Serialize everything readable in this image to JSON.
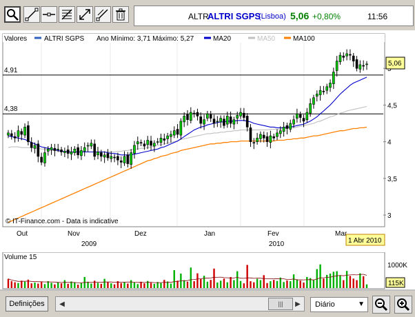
{
  "toolbar": {
    "icons": [
      "zoom-select-icon",
      "trend-line-icon",
      "horizontal-line-icon",
      "fibonacci-icon",
      "expand-arrows-icon",
      "diagonal-line-icon",
      "trash-icon"
    ]
  },
  "quote": {
    "ticker": "ALTR",
    "name": "ALTRI SGPS",
    "exchange": "(Lisboa)",
    "price": "5,06",
    "change": "+0,80%",
    "time": "11:56",
    "change_color": "#008000"
  },
  "legend": {
    "valores": "Valores",
    "series_name": "ALTRI SGPS",
    "range_text": "Ano Mínimo: 3,71 Máximo: 5,27",
    "ma20": "MA20",
    "ma50": "MA50",
    "ma100": "MA100",
    "colors": {
      "series": "#3060c0",
      "ma20": "#0000cc",
      "ma50": "#c0c0c0",
      "ma100": "#ff8000"
    }
  },
  "horizontal_lines": [
    {
      "label": "4,91",
      "value": 4.91
    },
    {
      "label": "4,38",
      "value": 4.38
    }
  ],
  "price_tag": "5,06",
  "watermark": "© IT-Finance.com - Data is indicative",
  "date_tag": "1 Abr 2010",
  "x_labels": {
    "months": [
      "Out",
      "Nov",
      "Dez",
      "Jan",
      "Fev",
      "Mar"
    ],
    "years": [
      "2009",
      "2010"
    ]
  },
  "volume": {
    "label": "Volume 15",
    "axis_top": "1000K",
    "current": "115K"
  },
  "chart_data": {
    "type": "candlestick",
    "y_axis_labels": [
      "5",
      "4,5",
      "4",
      "3,5",
      "3"
    ],
    "ylim": [
      2.85,
      5.35
    ],
    "grid": false,
    "closes": [
      4.12,
      4.08,
      4.05,
      4.15,
      4.1,
      4.2,
      4.0,
      3.92,
      3.95,
      3.8,
      3.72,
      3.85,
      3.9,
      3.92,
      3.88,
      3.9,
      3.86,
      3.87,
      3.84,
      3.86,
      3.9,
      3.82,
      3.88,
      3.92,
      3.95,
      3.98,
      3.8,
      3.86,
      3.8,
      3.82,
      3.78,
      3.8,
      3.78,
      3.75,
      3.72,
      3.8,
      3.7,
      3.85,
      3.95,
      4.0,
      3.98,
      3.94,
      4.02,
      3.95,
      3.98,
      4.0,
      4.05,
      4.02,
      4.08,
      4.1,
      4.15,
      4.1,
      4.28,
      4.35,
      4.3,
      4.4,
      4.38,
      4.35,
      4.25,
      4.3,
      4.38,
      4.32,
      4.25,
      4.28,
      4.32,
      4.22,
      4.35,
      4.25,
      4.3,
      4.36,
      4.4,
      4.33,
      4.2,
      4.0,
      3.98,
      4.05,
      4.1,
      4.05,
      4.0,
      4.08,
      4.05,
      4.12,
      4.15,
      4.2,
      4.18,
      4.25,
      4.3,
      4.38,
      4.33,
      4.28,
      4.4,
      4.52,
      4.6,
      4.65,
      4.7,
      4.68,
      4.75,
      4.8,
      4.95,
      5.1,
      5.18,
      5.15,
      5.2,
      5.18,
      5.1,
      5.0,
      5.05,
      5.03,
      5.06
    ],
    "ma20": [
      4.08,
      4.07,
      4.06,
      4.05,
      4.04,
      4.03,
      4.01,
      3.99,
      3.97,
      3.95,
      3.93,
      3.92,
      3.91,
      3.9,
      3.89,
      3.88,
      3.87,
      3.87,
      3.86,
      3.86,
      3.86,
      3.86,
      3.86,
      3.86,
      3.86,
      3.86,
      3.86,
      3.86,
      3.86,
      3.86,
      3.85,
      3.84,
      3.84,
      3.83,
      3.82,
      3.82,
      3.82,
      3.82,
      3.83,
      3.84,
      3.85,
      3.86,
      3.87,
      3.88,
      3.89,
      3.9,
      3.92,
      3.93,
      3.95,
      3.97,
      3.99,
      4.01,
      4.04,
      4.07,
      4.1,
      4.13,
      4.16,
      4.18,
      4.2,
      4.21,
      4.23,
      4.24,
      4.25,
      4.26,
      4.27,
      4.27,
      4.28,
      4.28,
      4.28,
      4.29,
      4.29,
      4.29,
      4.28,
      4.27,
      4.25,
      4.24,
      4.23,
      4.22,
      4.21,
      4.2,
      4.2,
      4.19,
      4.19,
      4.19,
      4.2,
      4.2,
      4.21,
      4.22,
      4.23,
      4.24,
      4.26,
      4.28,
      4.31,
      4.34,
      4.38,
      4.42,
      4.46,
      4.5,
      4.55,
      4.6,
      4.65,
      4.69,
      4.73,
      4.77,
      4.8,
      4.82,
      4.84,
      4.86,
      4.88
    ],
    "ma50": [
      3.92,
      3.93,
      3.93,
      3.93,
      3.92,
      3.92,
      3.92,
      3.92,
      3.91,
      3.91,
      3.9,
      3.9,
      3.89,
      3.88,
      3.88,
      3.87,
      3.87,
      3.87,
      3.87,
      3.86,
      3.86,
      3.86,
      3.86,
      3.86,
      3.86,
      3.86,
      3.86,
      3.86,
      3.86,
      3.86,
      3.86,
      3.86,
      3.86,
      3.87,
      3.87,
      3.88,
      3.88,
      3.89,
      3.9,
      3.9,
      3.91,
      3.91,
      3.92,
      3.93,
      3.94,
      3.95,
      3.96,
      3.97,
      3.98,
      3.99,
      4.0,
      4.01,
      4.03,
      4.04,
      4.05,
      4.06,
      4.07,
      4.08,
      4.09,
      4.1,
      4.11,
      4.11,
      4.12,
      4.12,
      4.13,
      4.13,
      4.14,
      4.14,
      4.15,
      4.15,
      4.16,
      4.16,
      4.16,
      4.16,
      4.16,
      4.16,
      4.16,
      4.16,
      4.16,
      4.17,
      4.17,
      4.17,
      4.17,
      4.18,
      4.18,
      4.19,
      4.19,
      4.2,
      4.21,
      4.22,
      4.23,
      4.24,
      4.25,
      4.27,
      4.28,
      4.3,
      4.32,
      4.34,
      4.35,
      4.37,
      4.39,
      4.4,
      4.42,
      4.43,
      4.44,
      4.45,
      4.46,
      4.47,
      4.48
    ],
    "ma100": [
      2.9,
      2.92,
      2.94,
      2.96,
      2.98,
      3.0,
      3.02,
      3.04,
      3.06,
      3.08,
      3.1,
      3.12,
      3.14,
      3.16,
      3.18,
      3.2,
      3.22,
      3.24,
      3.26,
      3.28,
      3.3,
      3.32,
      3.34,
      3.36,
      3.38,
      3.4,
      3.42,
      3.44,
      3.46,
      3.48,
      3.5,
      3.52,
      3.54,
      3.56,
      3.58,
      3.6,
      3.62,
      3.64,
      3.66,
      3.68,
      3.7,
      3.72,
      3.74,
      3.75,
      3.77,
      3.78,
      3.8,
      3.81,
      3.82,
      3.84,
      3.85,
      3.86,
      3.88,
      3.89,
      3.9,
      3.91,
      3.92,
      3.93,
      3.94,
      3.95,
      3.96,
      3.97,
      3.97,
      3.98,
      3.98,
      3.99,
      3.99,
      4.0,
      4.0,
      4.0,
      4.01,
      4.01,
      4.01,
      4.01,
      4.01,
      4.01,
      4.01,
      4.01,
      4.01,
      4.01,
      4.01,
      4.02,
      4.02,
      4.02,
      4.03,
      4.03,
      4.04,
      4.04,
      4.05,
      4.05,
      4.06,
      4.07,
      4.08,
      4.08,
      4.09,
      4.1,
      4.11,
      4.12,
      4.13,
      4.14,
      4.15,
      4.15,
      4.16,
      4.17,
      4.18,
      4.18,
      4.19,
      4.19,
      4.2
    ],
    "volumes": [
      350,
      260,
      220,
      190,
      280,
      240,
      320,
      180,
      210,
      170,
      230,
      150,
      260,
      200,
      140,
      220,
      180,
      300,
      160,
      250,
      210,
      130,
      190,
      420,
      240,
      170,
      280,
      200,
      160,
      350,
      220,
      180,
      140,
      260,
      190,
      230,
      170,
      300,
      210,
      150,
      240,
      180,
      270,
      200,
      160,
      230,
      190,
      310,
      250,
      170,
      680,
      280,
      550,
      300,
      240,
      780,
      260,
      560,
      340,
      470,
      240,
      310,
      740,
      210,
      280,
      360,
      220,
      420,
      300,
      640,
      270,
      180,
      880,
      260,
      220,
      350,
      300,
      490,
      190,
      260,
      310,
      270,
      400,
      230,
      290,
      260,
      520,
      330,
      280,
      210,
      420,
      380,
      300,
      720,
      900,
      360,
      500,
      550,
      620,
      640,
      480,
      300,
      650,
      460,
      360,
      300,
      560,
      450,
      140
    ],
    "volume_colors": [
      "red",
      "red",
      "red",
      "green",
      "red",
      "green",
      "red",
      "red",
      "green",
      "red",
      "red",
      "green",
      "green",
      "green",
      "red",
      "green",
      "red",
      "green",
      "red",
      "green",
      "green",
      "red",
      "green",
      "green",
      "green",
      "green",
      "red",
      "green",
      "red",
      "green",
      "red",
      "green",
      "red",
      "red",
      "red",
      "green",
      "red",
      "green",
      "green",
      "green",
      "red",
      "red",
      "green",
      "red",
      "green",
      "green",
      "green",
      "red",
      "green",
      "green",
      "green",
      "red",
      "green",
      "green",
      "red",
      "green",
      "red",
      "red",
      "red",
      "green",
      "green",
      "red",
      "red",
      "green",
      "green",
      "red",
      "green",
      "red",
      "green",
      "green",
      "green",
      "red",
      "red",
      "red",
      "red",
      "green",
      "green",
      "red",
      "red",
      "green",
      "red",
      "green",
      "green",
      "green",
      "red",
      "green",
      "green",
      "green",
      "red",
      "red",
      "green",
      "green",
      "green",
      "green",
      "green",
      "red",
      "green",
      "green",
      "green",
      "green",
      "green",
      "red",
      "green",
      "red",
      "red",
      "red",
      "green",
      "red",
      "green"
    ],
    "volume_ylim": [
      0,
      1100
    ]
  }
}
